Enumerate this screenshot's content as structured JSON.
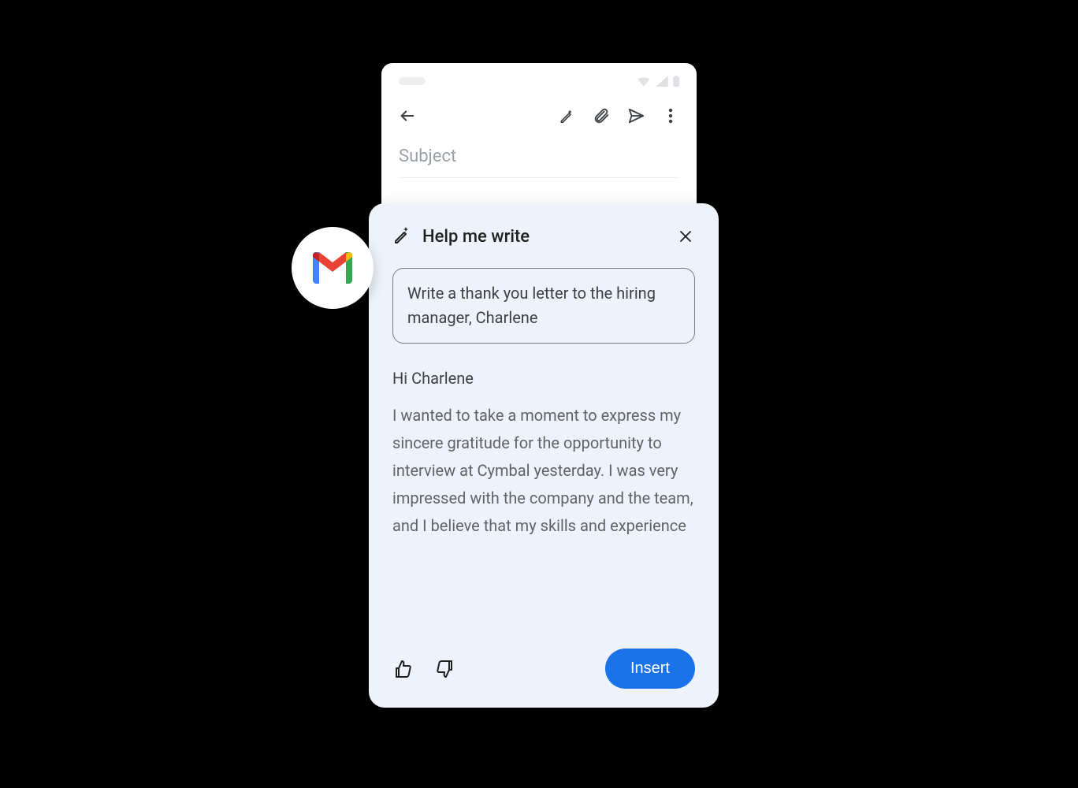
{
  "phone": {
    "subject_placeholder": "Subject"
  },
  "panel": {
    "title": "Help me write",
    "prompt": "Write a thank you letter to the hiring manager, Charlene",
    "greeting": "Hi Charlene",
    "body": "I wanted to take a moment to express my sincere gratitude for the opportunity to interview at Cymbal yesterday. I was very impressed with the company and the team, and I believe that my skills and experience",
    "insert_label": "Insert"
  }
}
